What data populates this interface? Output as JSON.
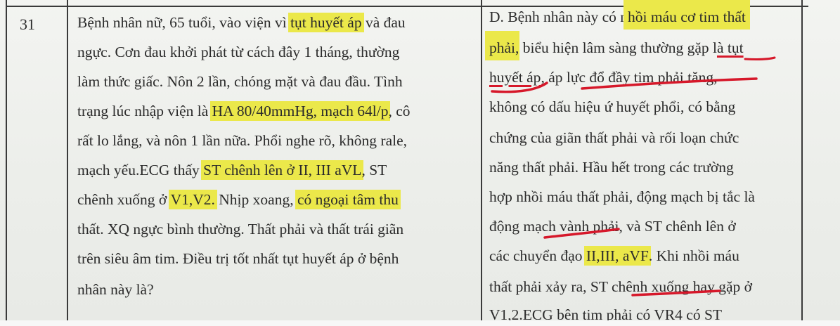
{
  "row_number": "31",
  "question": {
    "lines": [
      [
        {
          "t": "Bệnh nhân nữ, 65 tuổi, vào viện vì "
        },
        {
          "t": "tụt huyết áp",
          "hl": true
        },
        {
          "t": " và đau"
        }
      ],
      [
        {
          "t": "ngực. Cơn đau khởi phát từ cách đây 1 tháng, thường"
        }
      ],
      [
        {
          "t": "làm thức giấc. Nôn 2 lần, chóng mặt và đau đầu. Tình"
        }
      ],
      [
        {
          "t": "trạng lúc nhập viện là "
        },
        {
          "t": "HA  80/40mmHg,  mạch 64l/p",
          "hl": true
        },
        {
          "t": ", cô"
        }
      ],
      [
        {
          "t": "rất lo lắng, và nôn 1 lần nữa. Phổi nghe  rõ, không rale,"
        }
      ],
      [
        {
          "t": "mạch yếu.ECG thấy "
        },
        {
          "t": "ST chênh lên ở II, III aVL",
          "hl": true
        },
        {
          "t": ", ST"
        }
      ],
      [
        {
          "t": "chênh xuống ở "
        },
        {
          "t": "V1,V2.",
          "hl": true
        },
        {
          "t": " Nhịp xoang, "
        },
        {
          "t": "có ngoại tâm thu",
          "hl": true
        }
      ],
      [
        {
          "t": "thất. XQ ngực  bình thường. Thất phải và thất trái giãn"
        }
      ],
      [
        {
          "t": "trên siêu âm tim. Điều trị tốt nhất tụt huyết áp ở bệnh"
        }
      ],
      [
        {
          "t": "nhân này  là?"
        }
      ]
    ]
  },
  "answer": {
    "lines": [
      [
        {
          "t": "D. Bệnh nhân này có n"
        },
        {
          "t": "hồi máu cơ tim thất",
          "hl": true
        }
      ],
      [
        {
          "t": "phải",
          "hl": true
        },
        {
          "t": ", biểu hiện lâm sàng thường gặp l"
        },
        {
          "t": "à tụt",
          "ul": true
        }
      ],
      [
        {
          "t": "huyết áp",
          "ul": true
        },
        {
          "t": ", áp lực đổ đầy tim phải tăng,"
        }
      ],
      [
        {
          "t": "không có dấu hiệu ứ huyết phổi, có bằng"
        }
      ],
      [
        {
          "t": "chứng của giãn thất phải và rối loạn chức"
        }
      ],
      [
        {
          "t": "năng thất phải. Hầu hết trong các trường"
        }
      ],
      [
        {
          "t": "hợp nhồi máu thất phải, động mạch bị tắc là"
        }
      ],
      [
        {
          "t": "động mạch vành phải, và ST chênh lên ở"
        }
      ],
      [
        {
          "t": "các  chuyển đạo "
        },
        {
          "t": "II,III, aVF",
          "hl": true
        },
        {
          "t": ". Khi nhồi máu"
        }
      ],
      [
        {
          "t": "thất phải xảy ra, ST chênh xuống hay gặp ở"
        }
      ],
      [
        {
          "t": "V1,2.ECG bên tim phải có VR4 có ST"
        }
      ]
    ]
  },
  "colors": {
    "highlight": "#ebe84a",
    "pen_red": "#d6182a",
    "ink": "#2b2b2b",
    "paper": "#eceeea"
  }
}
